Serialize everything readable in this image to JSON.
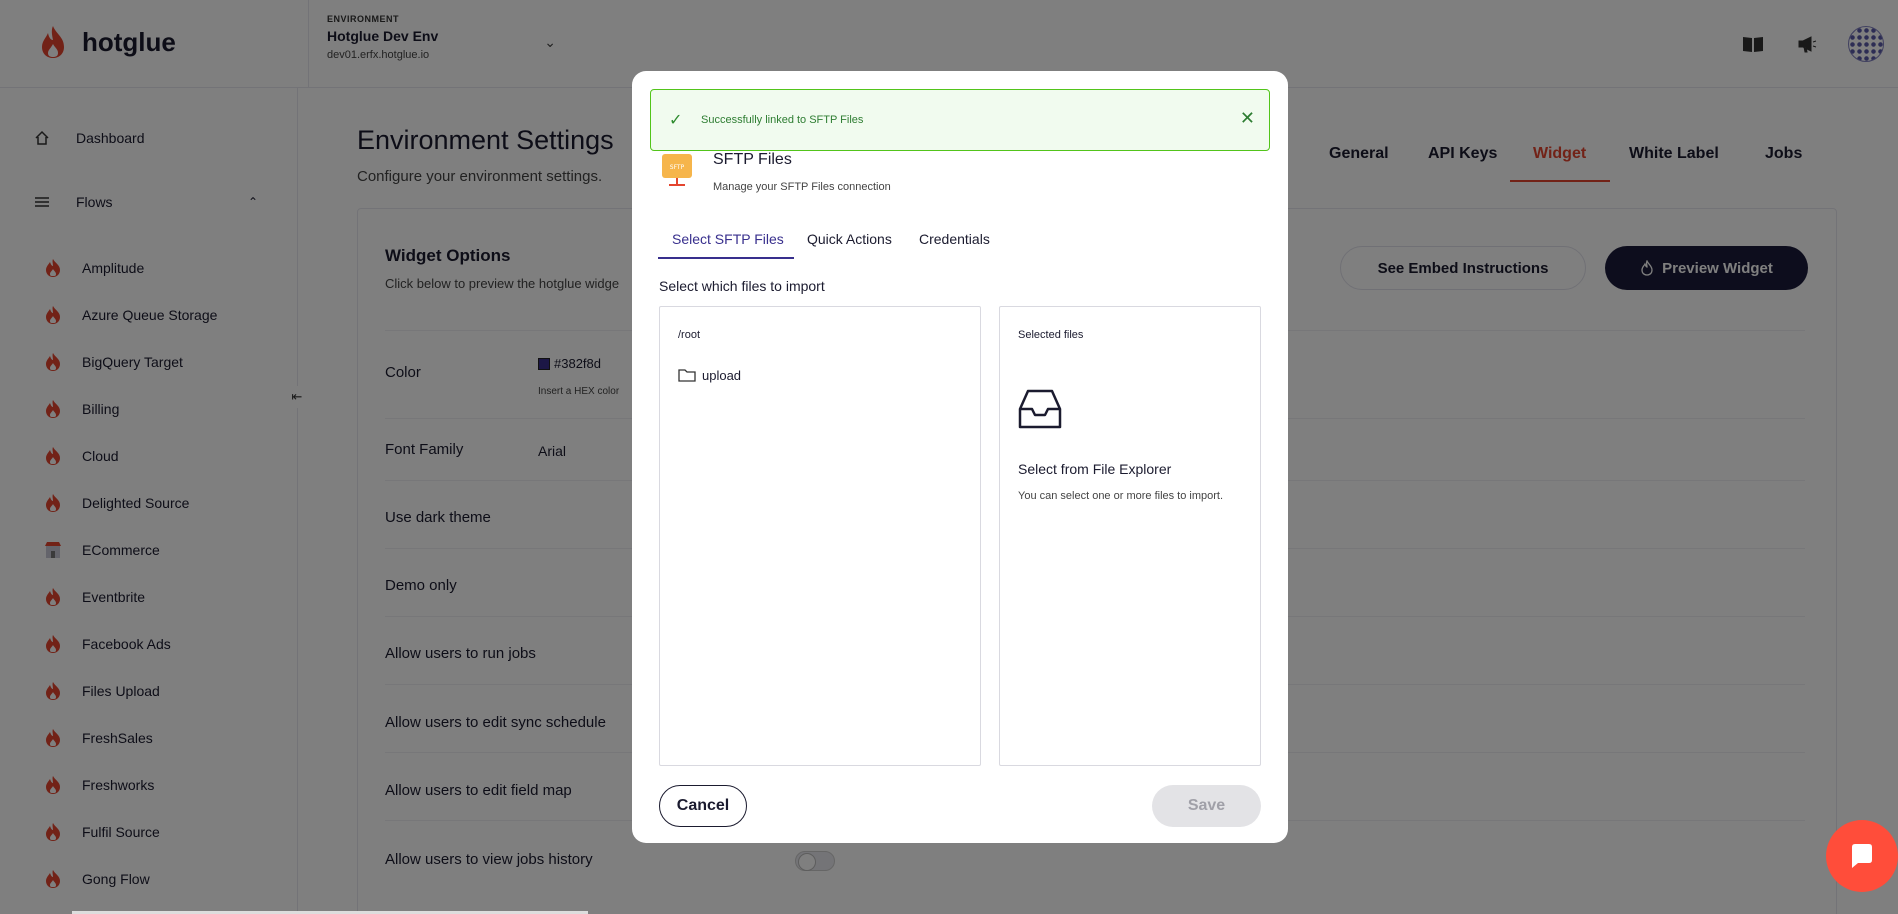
{
  "app": {
    "brand": "hotglue",
    "environment_label": "ENVIRONMENT",
    "environment_name": "Hotglue Dev Env",
    "environment_host": "dev01.erfx.hotglue.io"
  },
  "sidebar": {
    "dashboard": "Dashboard",
    "flows": "Flows",
    "flow_items": [
      "Amplitude",
      "Azure Queue Storage",
      "BigQuery Target",
      "Billing",
      "Cloud",
      "Delighted Source",
      "ECommerce",
      "Eventbrite",
      "Facebook Ads",
      "Files Upload",
      "FreshSales",
      "Freshworks",
      "Fulfil Source",
      "Gong Flow"
    ]
  },
  "page": {
    "title": "Environment Settings",
    "subtitle": "Configure your environment settings.",
    "tabs": [
      "General",
      "API Keys",
      "Widget",
      "White Label",
      "Jobs"
    ],
    "active_tab": "Widget"
  },
  "widget_options": {
    "title": "Widget Options",
    "subtitle": "Click below to preview the hotglue widge",
    "embed_button": "See Embed Instructions",
    "preview_button": "Preview Widget",
    "color_label": "Color",
    "color_value": "#382f8d",
    "color_help": "Insert a HEX color",
    "font_label": "Font Family",
    "font_value": "Arial",
    "options": [
      "Use dark theme",
      "Demo only",
      "Allow users to run jobs",
      "Allow users to edit sync schedule",
      "Allow users to edit field map",
      "Allow users to view jobs history"
    ]
  },
  "modal": {
    "toast": "Successfully linked to SFTP Files",
    "logo_text": "SFTP",
    "title": "SFTP Files",
    "subtitle": "Manage your SFTP Files connection",
    "tabs": [
      "Select SFTP Files",
      "Quick Actions",
      "Credentials"
    ],
    "instruction": "Select which files to import",
    "path": "/root",
    "folder": "upload",
    "selected_title": "Selected files",
    "empty_heading": "Select from File Explorer",
    "empty_help": "You can select one or more files to import.",
    "cancel": "Cancel",
    "save": "Save"
  },
  "colors": {
    "accent": "#382f8d",
    "brand_red": "#e4452f",
    "toast_border": "#52c41a",
    "chat": "#ff4d3a"
  }
}
